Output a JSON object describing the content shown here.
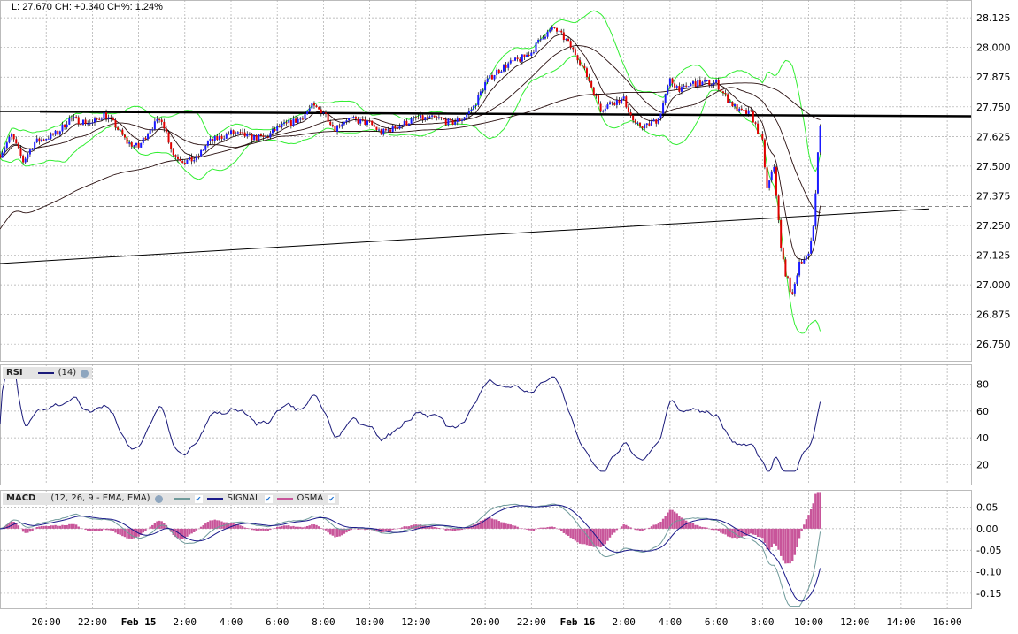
{
  "header": {
    "quote_text": "L: 27.670 CH: +0.340 CH%: 1.24%"
  },
  "rsi_legend": {
    "title": "RSI",
    "params": "(14)"
  },
  "macd_legend": {
    "title": "MACD",
    "params": "(12, 26, 9 - EMA, EMA)",
    "signal_label": "SIGNAL",
    "osma_label": "OSMA"
  },
  "colors": {
    "up": "#1a1aff",
    "down": "#e00000",
    "bands": "#33ee33",
    "ma": "#2a1010",
    "rsi": "#1a1a7a",
    "macd": "#6f9a9a",
    "signal": "#1a1a8a",
    "osma": "#c8559a",
    "grid": "#aaaaaa"
  },
  "chart_data": {
    "type": "line",
    "title": "",
    "x_unit": "session hours from chart start",
    "x_ticks": [
      {
        "x": 2,
        "label": "20:00"
      },
      {
        "x": 4,
        "label": "22:00"
      },
      {
        "x": 6,
        "label": "Feb 15",
        "bold": true
      },
      {
        "x": 8,
        "label": "2:00"
      },
      {
        "x": 10,
        "label": "4:00"
      },
      {
        "x": 12,
        "label": "6:00"
      },
      {
        "x": 14,
        "label": "8:00"
      },
      {
        "x": 16,
        "label": "10:00"
      },
      {
        "x": 18,
        "label": "12:00"
      },
      {
        "x": 21,
        "label": "20:00"
      },
      {
        "x": 23,
        "label": "22:00"
      },
      {
        "x": 25,
        "label": "Feb 16",
        "bold": true
      },
      {
        "x": 27,
        "label": "2:00"
      },
      {
        "x": 29,
        "label": "4:00"
      },
      {
        "x": 31,
        "label": "6:00"
      },
      {
        "x": 33,
        "label": "8:00"
      },
      {
        "x": 35,
        "label": "10:00"
      },
      {
        "x": 37,
        "label": "12:00"
      },
      {
        "x": 39,
        "label": "14:00"
      },
      {
        "x": 41,
        "label": "16:00"
      }
    ],
    "price_panel": {
      "ylim": [
        26.68,
        28.2
      ],
      "y_ticks": [
        "28.125",
        "28.000",
        "27.875",
        "27.750",
        "27.625",
        "27.500",
        "27.375",
        "27.250",
        "27.125",
        "27.000",
        "26.875",
        "26.750"
      ],
      "close_keypoints": [
        [
          0,
          27.55
        ],
        [
          0.5,
          27.63
        ],
        [
          1,
          27.52
        ],
        [
          1.5,
          27.6
        ],
        [
          2,
          27.62
        ],
        [
          2.5,
          27.64
        ],
        [
          3,
          27.7
        ],
        [
          4,
          27.68
        ],
        [
          4.5,
          27.72
        ],
        [
          5,
          27.67
        ],
        [
          5.5,
          27.6
        ],
        [
          6,
          27.58
        ],
        [
          6.5,
          27.66
        ],
        [
          7,
          27.7
        ],
        [
          7.5,
          27.55
        ],
        [
          8,
          27.52
        ],
        [
          8.5,
          27.53
        ],
        [
          9,
          27.6
        ],
        [
          9.5,
          27.62
        ],
        [
          10,
          27.64
        ],
        [
          11,
          27.62
        ],
        [
          11.5,
          27.62
        ],
        [
          12,
          27.66
        ],
        [
          13,
          27.7
        ],
        [
          13.5,
          27.75
        ],
        [
          14,
          27.73
        ],
        [
          14.5,
          27.66
        ],
        [
          15,
          27.7
        ],
        [
          16,
          27.68
        ],
        [
          16.5,
          27.64
        ],
        [
          17,
          27.66
        ],
        [
          18,
          27.7
        ],
        [
          19,
          27.7
        ],
        [
          19.5,
          27.68
        ],
        [
          20,
          27.7
        ],
        [
          20.5,
          27.75
        ],
        [
          21,
          27.85
        ],
        [
          21.5,
          27.9
        ],
        [
          22,
          27.93
        ],
        [
          22.5,
          27.95
        ],
        [
          23,
          27.98
        ],
        [
          23.5,
          28.05
        ],
        [
          24,
          28.08
        ],
        [
          24.5,
          28.03
        ],
        [
          25,
          27.96
        ],
        [
          25.5,
          27.86
        ],
        [
          26,
          27.74
        ],
        [
          26.5,
          27.77
        ],
        [
          27,
          27.78
        ],
        [
          27.5,
          27.67
        ],
        [
          28,
          27.67
        ],
        [
          28.5,
          27.7
        ],
        [
          29,
          27.86
        ],
        [
          29.5,
          27.82
        ],
        [
          30,
          27.85
        ],
        [
          30.5,
          27.85
        ],
        [
          31,
          27.85
        ],
        [
          31.5,
          27.78
        ],
        [
          32,
          27.73
        ],
        [
          32.5,
          27.72
        ],
        [
          33,
          27.6
        ],
        [
          33.2,
          27.4
        ],
        [
          33.5,
          27.5
        ],
        [
          33.8,
          27.15
        ],
        [
          34,
          27.05
        ],
        [
          34.3,
          26.95
        ],
        [
          34.6,
          27.1
        ],
        [
          35,
          27.12
        ],
        [
          35.2,
          27.25
        ],
        [
          35.4,
          27.55
        ],
        [
          35.5,
          27.67
        ]
      ],
      "horizontal_resistance": 27.72,
      "dashed_level": 27.33,
      "trendline": [
        [
          0,
          27.09
        ],
        [
          40.2,
          27.32
        ]
      ]
    },
    "rsi_panel": {
      "ylim": [
        5,
        95
      ],
      "y_ticks": [
        80,
        60,
        40,
        20
      ],
      "period": 14
    },
    "macd_panel": {
      "ylim": [
        -0.185,
        0.09
      ],
      "y_ticks": [
        "0.05",
        "0.00",
        "-0.05",
        "-0.10",
        "-0.15"
      ],
      "fast": 12,
      "slow": 26,
      "signal": 9
    }
  }
}
